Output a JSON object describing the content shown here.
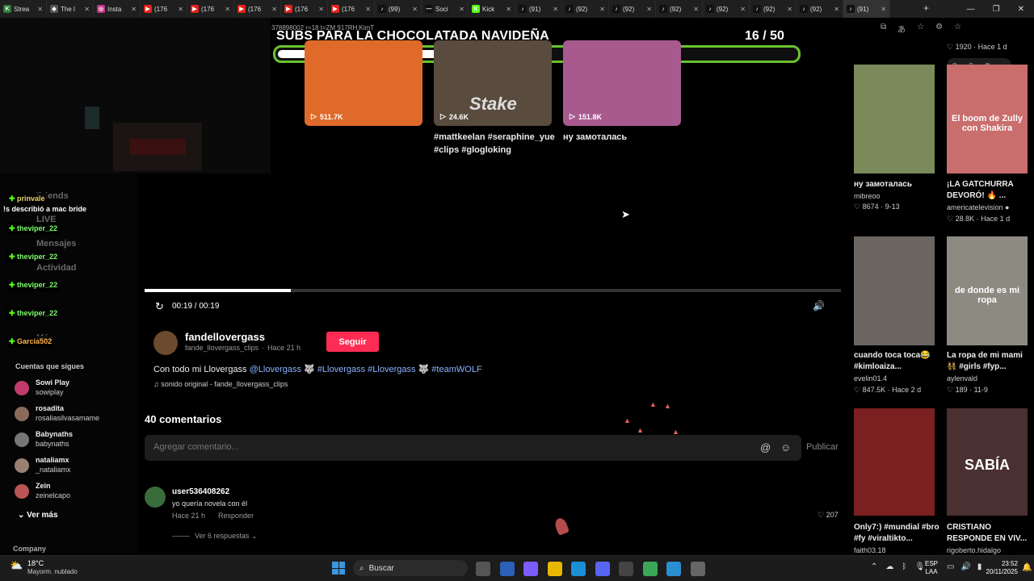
{
  "tabs": [
    {
      "title": "Strea",
      "color": "#2f7a3a",
      "glyph": "K"
    },
    {
      "title": "The l",
      "color": "#555",
      "glyph": "◆"
    },
    {
      "title": "Insta",
      "color": "#c13584",
      "glyph": "◎"
    },
    {
      "title": "(176",
      "color": "#e62117",
      "glyph": "▶"
    },
    {
      "title": "(176",
      "color": "#e62117",
      "glyph": "▶"
    },
    {
      "title": "(176",
      "color": "#e62117",
      "glyph": "▶"
    },
    {
      "title": "(176",
      "color": "#e62117",
      "glyph": "▶"
    },
    {
      "title": "(176",
      "color": "#e62117",
      "glyph": "▶"
    },
    {
      "title": "(99)",
      "color": "#111",
      "glyph": "♪"
    },
    {
      "title": "Soci",
      "color": "#111",
      "glyph": "—"
    },
    {
      "title": "Kick",
      "color": "#53fc18",
      "glyph": "K"
    },
    {
      "title": "(91)",
      "color": "#111",
      "glyph": "♪"
    },
    {
      "title": "(92)",
      "color": "#111",
      "glyph": "♪"
    },
    {
      "title": "(92)",
      "color": "#111",
      "glyph": "♪"
    },
    {
      "title": "(92)",
      "color": "#111",
      "glyph": "♪"
    },
    {
      "title": "(92)",
      "color": "#111",
      "glyph": "♪"
    },
    {
      "title": "(92)",
      "color": "#111",
      "glyph": "♪"
    },
    {
      "title": "(92)",
      "color": "#111",
      "glyph": "♪"
    },
    {
      "title": "(91)",
      "color": "#111",
      "glyph": "♪",
      "active": true
    }
  ],
  "banner": {
    "title": "SUBS PARA LA CHOCOLATADA NAVIDEÑA",
    "count": "16",
    "total": "/ 50",
    "progress": 0.32
  },
  "url_fragment": "378898002 r=18 t=ZM 917RH:KimT",
  "top_cards": [
    {
      "views": "511.7K",
      "caption": "",
      "bg": "#e06a2a"
    },
    {
      "views": "24.6K",
      "caption": "#mattkeelan #seraphine_yue #clips #glogloking",
      "bg": "#5a4b3f",
      "brand": "Stake"
    },
    {
      "views": "151.8K",
      "caption": "ну замоталась",
      "bg": "#a85a8f"
    }
  ],
  "player": {
    "time": "00:19 / 00:19",
    "progress": 0.21
  },
  "author": {
    "name": "fandellovergass",
    "handle": "fande_llovergass_clips",
    "time": "Hace 21 h",
    "follow": "Seguir"
  },
  "description": {
    "text": "Con todo mi Llovergass",
    "mention": "@Llovergass 🐺",
    "tags": "#Llovergass #Llovergass 🐺 #teamWOLF",
    "sound": "♫ sonido original - fande_llovergass_clips"
  },
  "comments": {
    "count": "40 comentarios",
    "placeholder": "Agregar comentario...",
    "publish": "Publicar",
    "first": {
      "user": "user536408262",
      "text": "yo quería novela con él",
      "time": "Hace 21 h",
      "reply": "Responder",
      "likes": "207",
      "replies": "Ver 6 respuestas ⌄"
    }
  },
  "sidebar": {
    "friends": "Friends",
    "live": "LIVE",
    "messages": "Mensajes",
    "activity": "Actividad",
    "more": "Más",
    "following_title": "Cuentas que sigues",
    "accounts": [
      {
        "name": "Sowi Play",
        "handle": "sowiplay",
        "color": "#c23b6f"
      },
      {
        "name": "rosadita",
        "handle": "rosaliasilvasamame",
        "color": "#8a6a5a"
      },
      {
        "name": "Babynaths",
        "handle": "babynaths",
        "color": "#777"
      },
      {
        "name": "nataliamx",
        "handle": "_nataliamx",
        "color": "#9a8070"
      },
      {
        "name": "Zein",
        "handle": "zeinelcapo",
        "color": "#b55"
      }
    ],
    "see_more": "Ver más",
    "company": "Company",
    "chat": [
      {
        "user": "prinvale",
        "color": "#e8d36a"
      },
      {
        "msg": "!s describió a mac bride"
      },
      {
        "user": "theviper_22",
        "color": "#7cff6a"
      },
      {
        "user": "theviper_22",
        "color": "#7cff6a"
      },
      {
        "user": "theviper_22",
        "color": "#7cff6a"
      },
      {
        "user": "theviper_22",
        "color": "#7cff6a"
      },
      {
        "user": "Garcia502",
        "color": "#ffb347"
      }
    ]
  },
  "right_feed": [
    {
      "caption": "ну замоталась",
      "sub": "mibreoo",
      "stats": "♡ 8674 · 9-13",
      "bg": "#7a8a5a"
    },
    {
      "caption": "¡LA GATCHURRA DEVORÓ! 🔥 ...",
      "sub": "americatelevision ●",
      "stats": "♡ 28.8K · Hace 1 d",
      "bg": "#c96d6d",
      "overlay": "El boom de Zully con Shakira"
    },
    {
      "caption": "cuando toca toca😂 #kimloaiza...",
      "sub": "evelin01.4",
      "stats": "♡ 847.5K · Hace 2 d",
      "bg": "#6b6560"
    },
    {
      "caption": "La ropa de mi mami 👯 #girls #fyp...",
      "sub": "aylenvald",
      "stats": "♡ 189 · 11-9",
      "bg": "#8d8a82",
      "overlay": "de donde es mi ropa"
    },
    {
      "caption": "Only7:) #mundial #bro #fy #viraltikto...",
      "sub": "faith03.18",
      "stats": "",
      "bg": "#7a2020"
    },
    {
      "caption": "CRISTIANO RESPONDE EN VIV...",
      "sub": "rigoberto.hidalgo",
      "stats": "",
      "bg": "#4a3030",
      "overlay": "SABÍA"
    }
  ],
  "right_top": {
    "stats": "♡ 1920 · Hace 1 d"
  },
  "taskbar": {
    "temp": "18°C",
    "weather": "Mayorm. nublado",
    "search": "Buscar",
    "lang": "ESP",
    "lang2": "LAA",
    "time": "23:52",
    "date": "20/11/2025"
  }
}
